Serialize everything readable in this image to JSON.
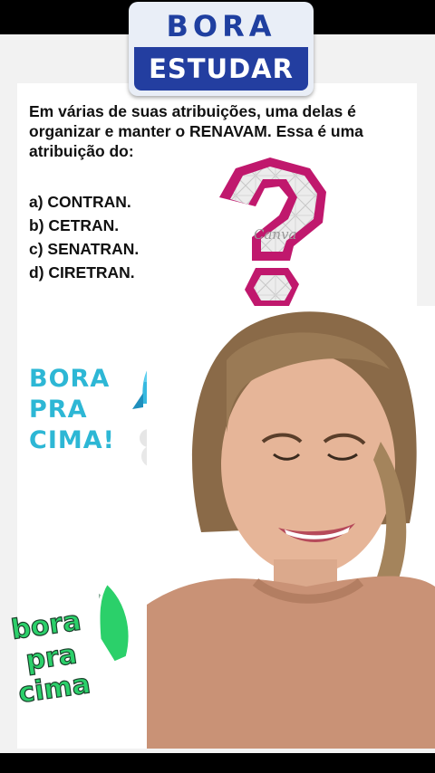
{
  "logo": {
    "line1": "BORA",
    "line2": "ESTUDAR"
  },
  "question": {
    "text": "Em várias de suas atribuições, uma delas é organizar e manter o RENAVAM.  Essa é uma atribuição do:"
  },
  "options": [
    "a) CONTRAN.",
    "b) CETRAN.",
    "c) SENATRAN.",
    "d) CIRETRAN."
  ],
  "qmark": {
    "watermark": "Canva",
    "color": "#c0186d"
  },
  "bora_pra_cima": {
    "line1": "BORA",
    "line2": "PRA",
    "line3": "CIMA!",
    "color": "#2db7d5"
  },
  "sticker": {
    "line1": "bora",
    "line2": "pra",
    "line3": "cima",
    "color": "#2bd06a"
  },
  "icons": [
    "question-mark-icon",
    "rocket-icon",
    "rocket-sticker-icon"
  ]
}
